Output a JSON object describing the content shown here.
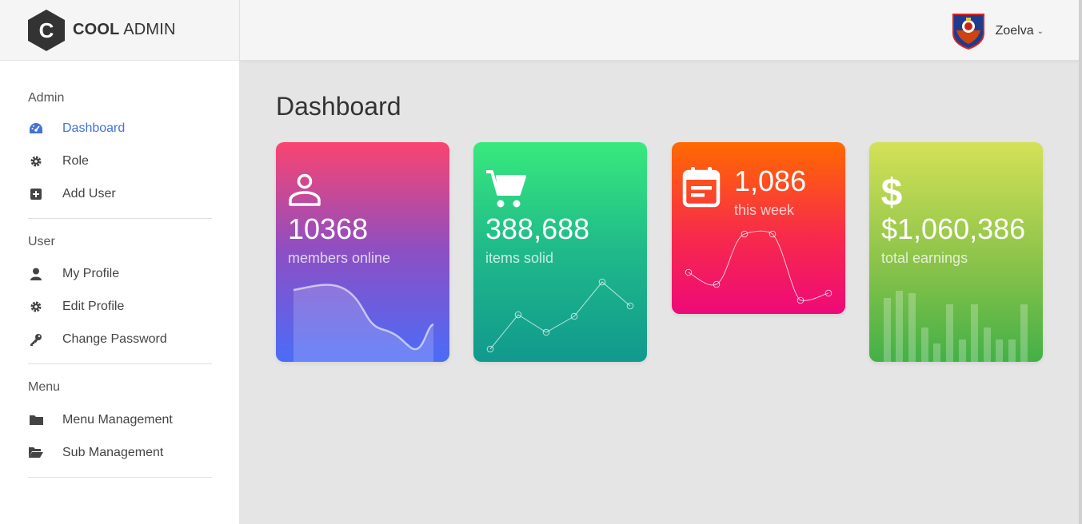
{
  "brand": {
    "bold": "COOL",
    "light": "ADMIN",
    "letter": "C"
  },
  "header": {
    "username": "Zoelva",
    "caret": "⌄"
  },
  "sidebar": {
    "groups": [
      {
        "title": "Admin",
        "items": [
          {
            "label": "Dashboard",
            "icon": "dashboard-icon",
            "active": true
          },
          {
            "label": "Role",
            "icon": "gear-icon"
          },
          {
            "label": "Add User",
            "icon": "plus-square-icon"
          }
        ]
      },
      {
        "title": "User",
        "items": [
          {
            "label": "My Profile",
            "icon": "user-icon"
          },
          {
            "label": "Edit Profile",
            "icon": "gear-icon"
          },
          {
            "label": "Change Password",
            "icon": "key-icon"
          }
        ]
      },
      {
        "title": "Menu",
        "items": [
          {
            "label": "Menu Management",
            "icon": "folder-icon"
          },
          {
            "label": "Sub Management",
            "icon": "folder-open-icon"
          }
        ]
      }
    ]
  },
  "page": {
    "title": "Dashboard"
  },
  "cards": [
    {
      "value": "10368",
      "label": "members online",
      "icon": "user-outline-icon"
    },
    {
      "value": "388,688",
      "label": "items solid",
      "icon": "shopping-cart-icon"
    },
    {
      "value": "1,086",
      "label": "this week",
      "icon": "calendar-icon"
    },
    {
      "value": "$1,060,386",
      "label": "total earnings",
      "icon": "dollar-icon"
    }
  ],
  "colors": {
    "active": "#4272d7",
    "c1_top": "#fa4470",
    "c1_bottom": "#4b6cf8",
    "c2_top": "#38e97d",
    "c2_bottom": "#11998e",
    "c3_top": "#ff6a00",
    "c3_bottom": "#ee0979",
    "c4_top": "#d4e157",
    "c4_bottom": "#43b047"
  }
}
